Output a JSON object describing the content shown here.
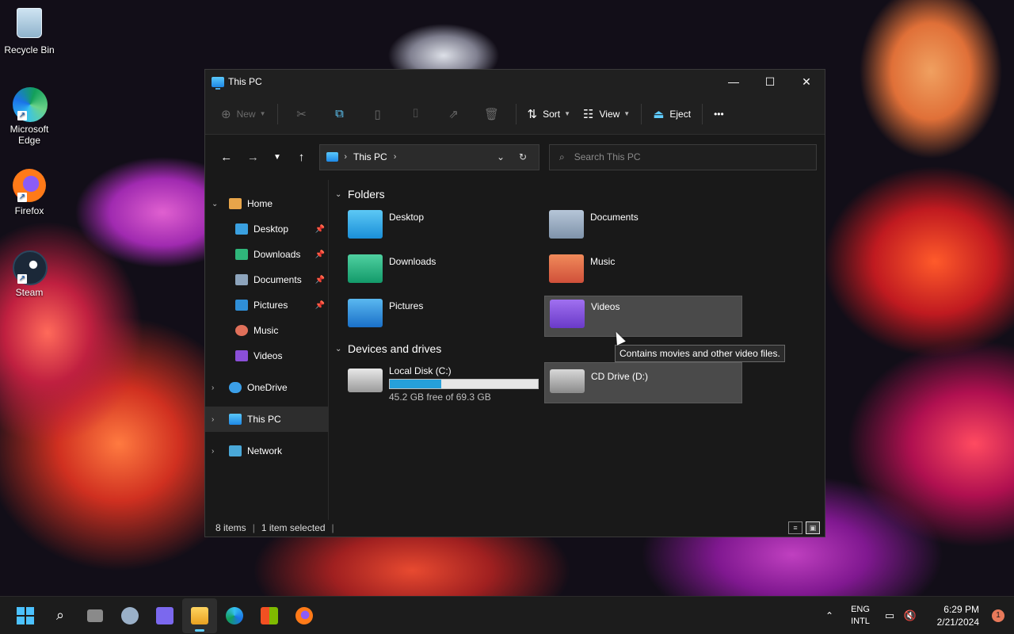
{
  "desktop": {
    "icons": [
      {
        "label": "Recycle Bin"
      },
      {
        "label": "Microsoft Edge"
      },
      {
        "label": "Firefox"
      },
      {
        "label": "Steam"
      }
    ]
  },
  "window": {
    "title": "This PC",
    "controls": {
      "minimize": "—",
      "maximize": "☐",
      "close": "✕"
    }
  },
  "toolbar": {
    "new_label": "New",
    "sort_label": "Sort",
    "view_label": "View",
    "eject_label": "Eject",
    "more_label": "•••"
  },
  "address": {
    "crumbs": [
      "This PC"
    ],
    "search_placeholder": "Search This PC"
  },
  "navpane": {
    "items": [
      {
        "label": "Home"
      },
      {
        "label": "Desktop"
      },
      {
        "label": "Downloads"
      },
      {
        "label": "Documents"
      },
      {
        "label": "Pictures"
      },
      {
        "label": "Music"
      },
      {
        "label": "Videos"
      },
      {
        "label": "OneDrive"
      },
      {
        "label": "This PC"
      },
      {
        "label": "Network"
      }
    ]
  },
  "content": {
    "folders_header": "Folders",
    "folders": [
      {
        "name": "Desktop"
      },
      {
        "name": "Documents"
      },
      {
        "name": "Downloads"
      },
      {
        "name": "Music"
      },
      {
        "name": "Pictures"
      },
      {
        "name": "Videos"
      }
    ],
    "drives_header": "Devices and drives",
    "drives": [
      {
        "name": "Local Disk (C:)",
        "free_text": "45.2 GB free of 69.3 GB",
        "used_fraction": 0.348
      },
      {
        "name": "CD Drive (D:)"
      }
    ],
    "tooltip": "Contains movies and other video files."
  },
  "status": {
    "items": "8 items",
    "selected": "1 item selected"
  },
  "taskbar": {
    "tray": {
      "lang_top": "ENG",
      "lang_bottom": "INTL",
      "time": "6:29 PM",
      "date": "2/21/2024",
      "notification_count": "1"
    }
  },
  "colors": {
    "accent": "#60cdff",
    "drive_fill": "#26a0da"
  }
}
